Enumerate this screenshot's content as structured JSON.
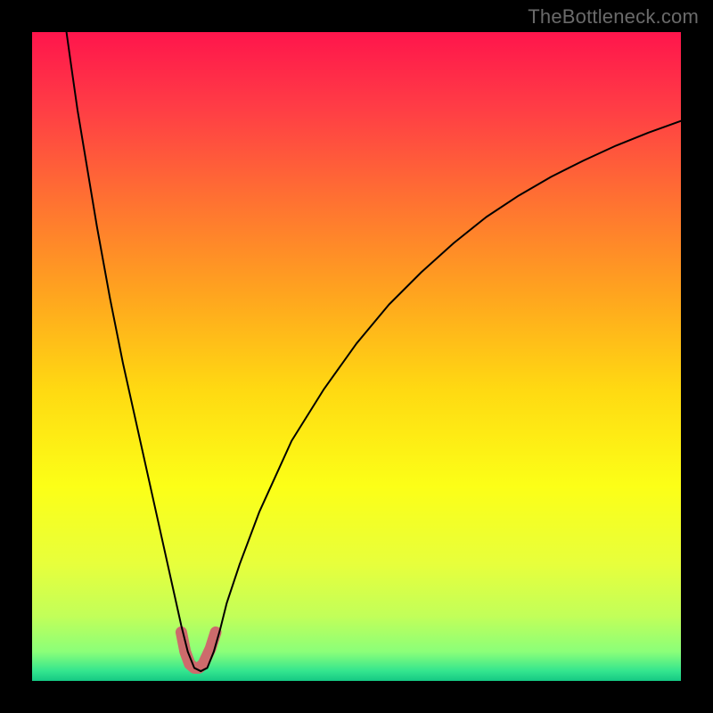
{
  "watermark": "TheBottleneck.com",
  "chart_data": {
    "type": "line",
    "title": "",
    "xlabel": "",
    "ylabel": "",
    "xlim": [
      0,
      100
    ],
    "ylim": [
      0,
      100
    ],
    "grid": false,
    "legend": false,
    "notes": "Bottleneck-style V curve over vertical rainbow gradient (red top→green bottom). Axes unlabeled; values estimated from pixel positions on 0–100 normalized range.",
    "series": [
      {
        "name": "bottleneck-curve",
        "color": "#000000",
        "x": [
          5.3,
          6,
          7,
          8,
          10,
          12,
          14,
          16,
          18,
          20,
          22,
          23,
          24,
          25,
          26,
          27,
          28,
          29,
          30,
          32,
          35,
          40,
          45,
          50,
          55,
          60,
          65,
          70,
          75,
          80,
          85,
          90,
          95,
          100
        ],
        "y": [
          100,
          95,
          88,
          82,
          70,
          59,
          49,
          40,
          31,
          22,
          13,
          8.5,
          4.5,
          2,
          1.5,
          2,
          4.5,
          8,
          12,
          18,
          26,
          37,
          45,
          52,
          58,
          63,
          67.5,
          71.5,
          74.8,
          77.7,
          80.2,
          82.5,
          84.5,
          86.3
        ]
      },
      {
        "name": "highlight-band",
        "color": "#cd6b6c",
        "stroke_width": 13,
        "x": [
          23,
          23.6,
          24.3,
          25,
          25.7,
          26.4,
          27.5,
          28.3
        ],
        "y": [
          7.5,
          4.5,
          2.6,
          2,
          2,
          2.6,
          5,
          7.5
        ]
      }
    ],
    "background_gradient": {
      "direction": "vertical",
      "stops": [
        {
          "pos": 0.0,
          "color": "#ff154c"
        },
        {
          "pos": 0.12,
          "color": "#ff3e45"
        },
        {
          "pos": 0.25,
          "color": "#ff6e33"
        },
        {
          "pos": 0.4,
          "color": "#ffa31f"
        },
        {
          "pos": 0.55,
          "color": "#ffd912"
        },
        {
          "pos": 0.7,
          "color": "#fcff17"
        },
        {
          "pos": 0.82,
          "color": "#e7ff3c"
        },
        {
          "pos": 0.9,
          "color": "#c2ff59"
        },
        {
          "pos": 0.955,
          "color": "#8bff79"
        },
        {
          "pos": 0.985,
          "color": "#33e58e"
        },
        {
          "pos": 1.0,
          "color": "#15c884"
        }
      ]
    }
  }
}
